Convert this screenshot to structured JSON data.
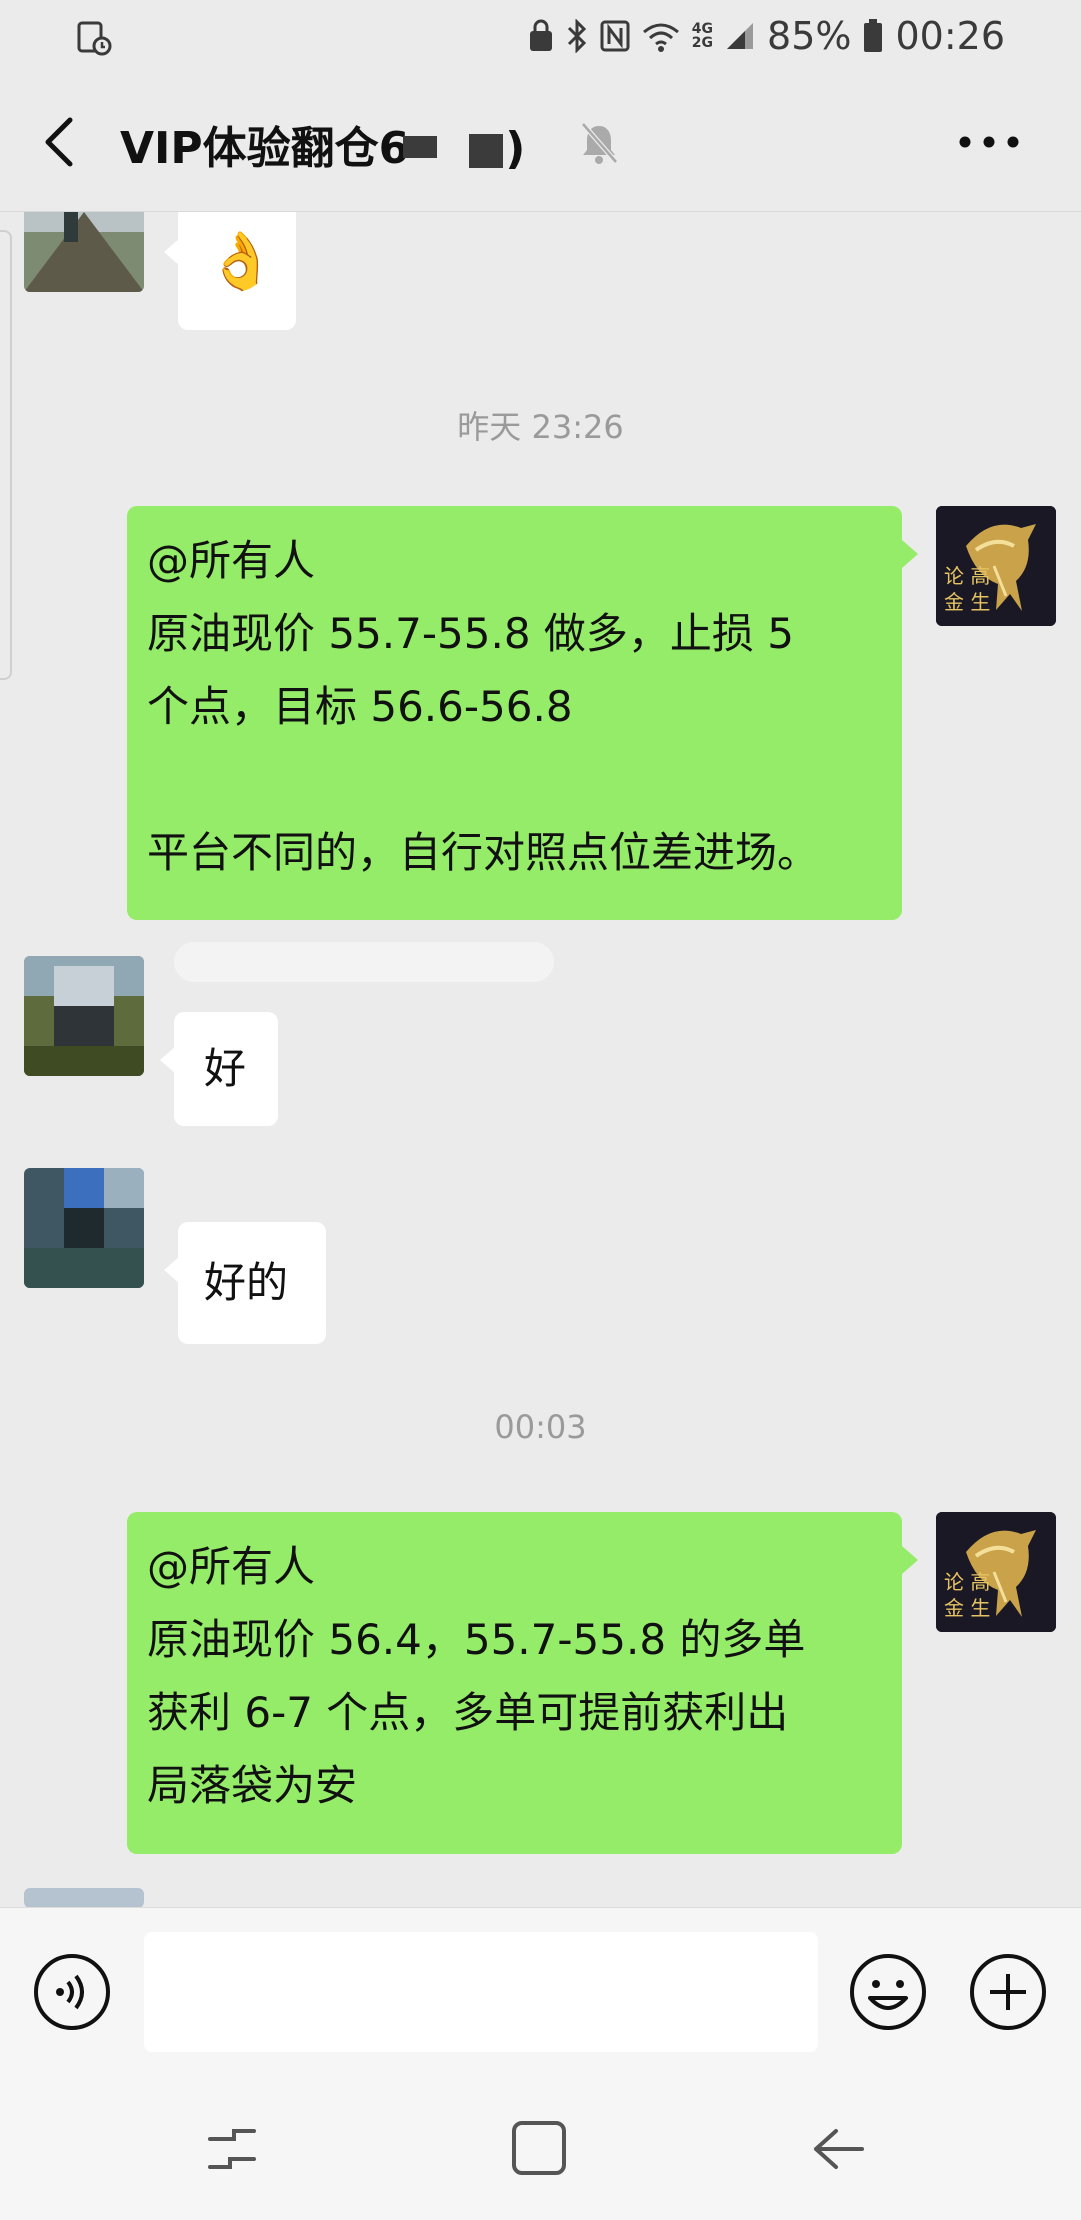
{
  "status_bar": {
    "battery_percent": "85%",
    "time": "00:26",
    "network_top": "4G",
    "network_bottom": "2G",
    "icons": [
      "screen-record-icon",
      "lock-icon",
      "bluetooth-icon",
      "nfc-icon",
      "wifi-icon",
      "signal-icon",
      "battery-icon"
    ]
  },
  "header": {
    "title": "VIP体验翻仓6",
    "title_suffix": ")",
    "icons": [
      "back-arrow-icon",
      "mute-bell-icon",
      "more-dots-icon"
    ]
  },
  "messages": [
    {
      "type": "incoming",
      "text": "👌"
    },
    {
      "type": "timestamp",
      "text": "昨天 23:26"
    },
    {
      "type": "outgoing",
      "lines": [
        "@所有人",
        "原油现价 55.7-55.8 做多，止损 5",
        "个点，目标 56.6-56.8",
        "",
        "平台不同的，自行对照点位差进场。"
      ],
      "avatar_text": [
        "论 高",
        "金 生"
      ]
    },
    {
      "type": "incoming",
      "text": "好"
    },
    {
      "type": "incoming",
      "text": "好的"
    },
    {
      "type": "timestamp",
      "text": "00:03"
    },
    {
      "type": "outgoing",
      "lines": [
        "@所有人",
        "原油现价 56.4，55.7-55.8 的多单",
        "获利 6-7 个点，多单可提前获利出",
        "局落袋为安"
      ],
      "avatar_text": [
        "论 高",
        "金 生"
      ]
    }
  ],
  "input_bar": {
    "placeholder": "",
    "icons": [
      "voice-icon",
      "emoji-icon",
      "plus-icon"
    ]
  },
  "nav_bar": {
    "icons": [
      "recent-apps-icon",
      "home-icon",
      "back-icon"
    ]
  },
  "colors": {
    "background": "#ebebeb",
    "outgoing_bubble": "#95ec69",
    "incoming_bubble": "#ffffff",
    "timestamp": "#9a9a9a"
  }
}
